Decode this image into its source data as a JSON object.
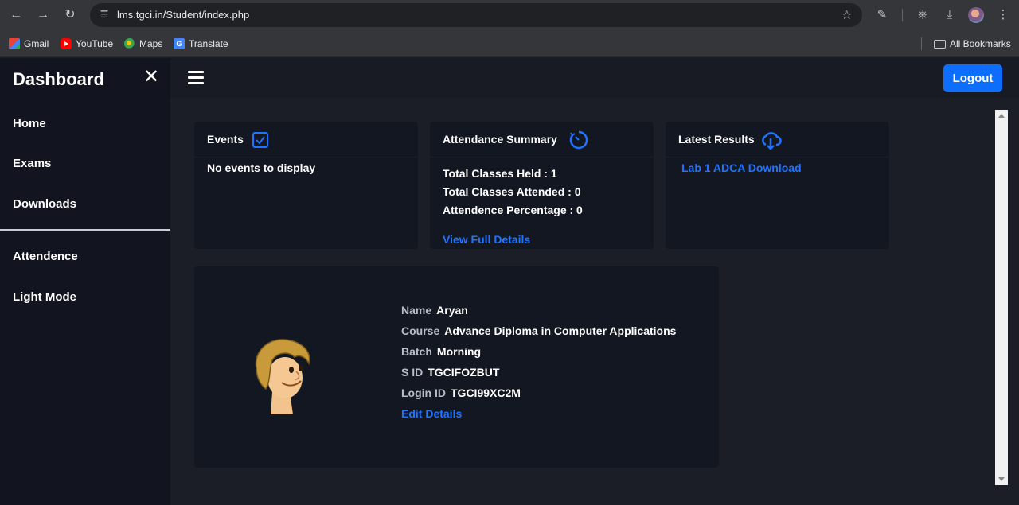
{
  "browser": {
    "url": "lms.tgci.in/Student/index.php",
    "bookmarks": [
      {
        "label": "Gmail",
        "icon": "gmail-icon",
        "color": "#ea4335"
      },
      {
        "label": "YouTube",
        "icon": "youtube-icon",
        "color": "#ff0000"
      },
      {
        "label": "Maps",
        "icon": "maps-icon",
        "color": "#34a853"
      },
      {
        "label": "Translate",
        "icon": "translate-icon",
        "color": "#4285f4"
      }
    ],
    "all_bookmarks": "All Bookmarks"
  },
  "sidebar": {
    "title": "Dashboard",
    "close_icon": "close-icon",
    "items": [
      {
        "label": "Home"
      },
      {
        "label": "Exams"
      },
      {
        "label": "Downloads"
      },
      {
        "label": "Attendence"
      },
      {
        "label": "Light Mode"
      }
    ]
  },
  "topbar": {
    "menu_icon": "hamburger-icon",
    "logout_label": "Logout",
    "logout_color": "#0d6efd"
  },
  "events": {
    "title": "Events",
    "icon": "checkbox-icon",
    "empty_text": "No events to display"
  },
  "attendance": {
    "title": "Attendance Summary",
    "icon": "timer-icon",
    "held": "Total Classes Held : 1",
    "attended": "Total Classes Attended : 0",
    "percentage": "Attendence Percentage : 0",
    "link": "View Full Details"
  },
  "results": {
    "title": "Latest Results",
    "icon": "cloud-download-icon",
    "items": [
      {
        "label": "Lab 1 ADCA Download"
      }
    ]
  },
  "profile": {
    "avatar": "cartoon-avatar-icon",
    "name_label": "Name",
    "name": "Aryan",
    "course_label": "Course",
    "course": "Advance Diploma in Computer Applications",
    "batch_label": "Batch",
    "batch": "Morning",
    "sid_label": "S ID",
    "sid": "TGCIFOZBUT",
    "login_label": "Login ID",
    "login": "TGCI99XC2M",
    "edit_link": "Edit Details"
  },
  "colors": {
    "link": "#1f74ff",
    "card_bg": "#131722",
    "page_bg": "#1b1e27",
    "sidebar_bg": "#121520"
  }
}
